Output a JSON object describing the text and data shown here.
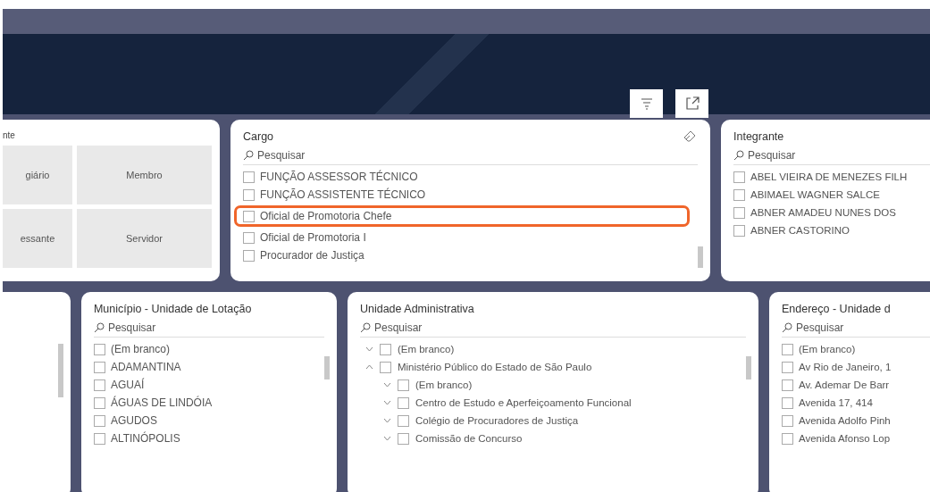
{
  "top_row": [
    {
      "kind": "tiles",
      "title": "nte",
      "tiles": [
        {
          "label": "giário",
          "selected": false
        },
        {
          "label": "Membro",
          "selected": false
        },
        {
          "label": "essante",
          "selected": false
        },
        {
          "label": "Servidor",
          "selected": false
        }
      ]
    },
    {
      "kind": "list",
      "title": "Cargo",
      "eraser": true,
      "search": {
        "placeholder": "Pesquisar"
      },
      "scrollbar": true,
      "items": [
        {
          "label": "FUNÇÃO ASSESSOR TÉCNICO",
          "checked": false,
          "highlighted": false
        },
        {
          "label": "FUNÇÃO ASSISTENTE TÉCNICO",
          "checked": false,
          "highlighted": false
        },
        {
          "label": "Oficial de Promotoria Chefe",
          "checked": false,
          "highlighted": true
        },
        {
          "label": "Oficial de Promotoria I",
          "checked": false,
          "highlighted": false
        },
        {
          "label": "Procurador de Justiça",
          "checked": false,
          "highlighted": false
        }
      ]
    },
    {
      "kind": "list",
      "title": "Integrante",
      "search": {
        "placeholder": "Pesquisar"
      },
      "items": [
        {
          "label": "ABEL VIEIRA DE MENEZES FILH",
          "checked": false,
          "highlighted": false
        },
        {
          "label": "ABIMAEL WAGNER SALCE",
          "checked": false,
          "highlighted": false
        },
        {
          "label": "ABNER AMADEU NUNES DOS",
          "checked": false,
          "highlighted": false
        },
        {
          "label": "ABNER CASTORINO",
          "checked": false,
          "highlighted": false
        }
      ]
    }
  ],
  "bottom_row": [
    {
      "kind": "blank",
      "scrollbar": true
    },
    {
      "kind": "list",
      "title": "Município - Unidade de Lotação",
      "search": {
        "placeholder": "Pesquisar"
      },
      "scrollbar": true,
      "items": [
        {
          "label": "(Em branco)",
          "checked": false,
          "highlighted": false
        },
        {
          "label": "ADAMANTINA",
          "checked": false,
          "highlighted": false
        },
        {
          "label": "AGUAÍ",
          "checked": false,
          "highlighted": false
        },
        {
          "label": "ÁGUAS DE LINDÓIA",
          "checked": false,
          "highlighted": false
        },
        {
          "label": "AGUDOS",
          "checked": false,
          "highlighted": false
        },
        {
          "label": "ALTINÓPOLIS",
          "checked": false,
          "highlighted": false
        }
      ]
    },
    {
      "kind": "tree",
      "title": "Unidade Administrativa",
      "search": {
        "placeholder": "Pesquisar"
      },
      "scrollbar": true,
      "items": [
        {
          "label": "(Em branco)",
          "checked": false,
          "expanded": false
        },
        {
          "label": "Ministério Público do Estado de São Paulo",
          "checked": false,
          "expanded": true,
          "children": [
            {
              "label": "(Em branco)",
              "checked": false,
              "expanded": false
            },
            {
              "label": "Centro de Estudo e Aperfeiçoamento Funcional",
              "checked": false,
              "expanded": false
            },
            {
              "label": "Colégio de Procuradores de Justiça",
              "checked": false,
              "expanded": false
            },
            {
              "label": "Comissão de Concurso",
              "checked": false,
              "expanded": false
            }
          ]
        }
      ]
    },
    {
      "kind": "list",
      "title": "Endereço - Unidade d",
      "search": {
        "placeholder": "Pesquisar"
      },
      "items": [
        {
          "label": "(Em branco)",
          "checked": false,
          "highlighted": false
        },
        {
          "label": "Av Rio de Janeiro, 1",
          "checked": false,
          "highlighted": false
        },
        {
          "label": "Av. Ademar De Barr",
          "checked": false,
          "highlighted": false
        },
        {
          "label": "Avenida 17, 414",
          "checked": false,
          "highlighted": false
        },
        {
          "label": "Avenida Adolfo Pinh",
          "checked": false,
          "highlighted": false
        },
        {
          "label": "Avenida Afonso Lop",
          "checked": false,
          "highlighted": false
        }
      ]
    }
  ]
}
